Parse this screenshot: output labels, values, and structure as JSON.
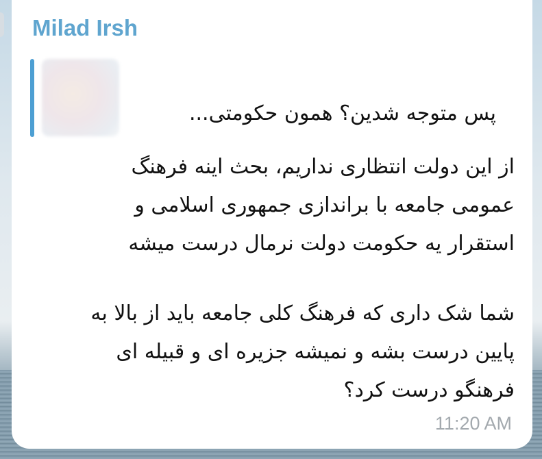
{
  "message": {
    "sender": "Milad Irsh",
    "reply_preview": {
      "text": "پس متوجه شدین؟ همون حکومتی..."
    },
    "paragraph1": [
      "از این دولت انتظاری نداریم، بحث اینه فرهنگ",
      "عمومی جامعه با براندازی جمهوری اسلامی و",
      "استقرار یه حکومت دولت نرمال درست میشه"
    ],
    "paragraph2": [
      "شما شک داری که فرهنگ کلی جامعه باید از بالا به",
      "پایین درست بشه و نمیشه جزیره ای و قبیله ای",
      "فرهنگو درست کرد؟"
    ],
    "time": "11:20 AM"
  },
  "colors": {
    "sender": "#5fa5cf",
    "reply_bar": "#4d9fd3",
    "bubble": "#ffffff",
    "time": "#a3a9ae"
  }
}
